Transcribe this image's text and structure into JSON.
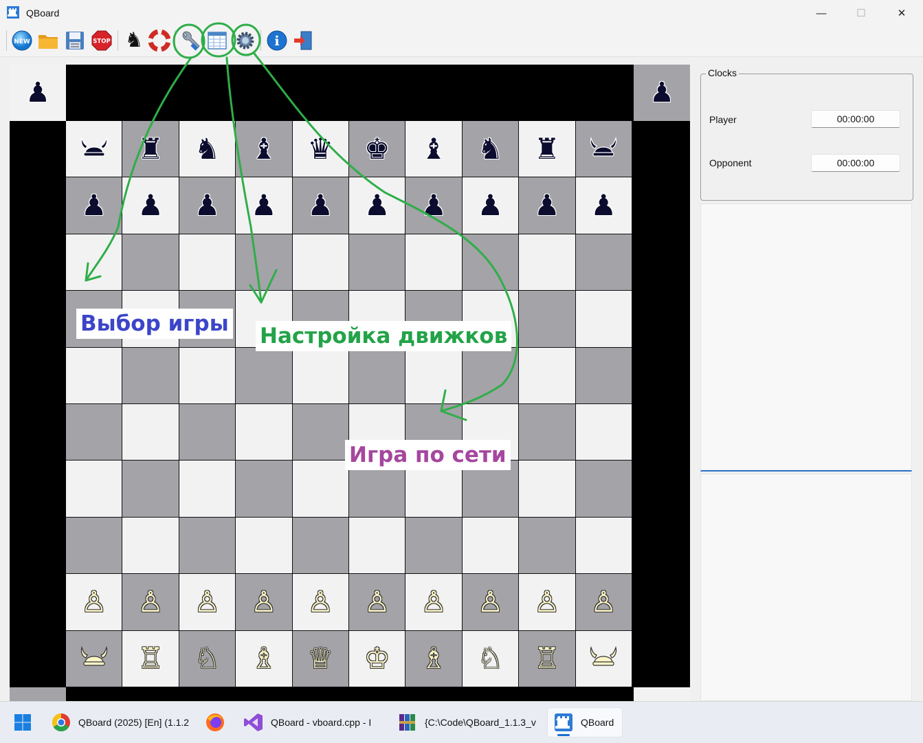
{
  "window": {
    "title": "QBoard",
    "minimize_glyph": "—",
    "maximize_glyph": "☐",
    "close_glyph": "✕"
  },
  "toolbar": {
    "buttons": [
      {
        "icon": "new-icon",
        "label": "NEW"
      },
      {
        "icon": "open-folder-icon"
      },
      {
        "icon": "save-icon"
      },
      {
        "icon": "stop-icon",
        "label": "STOP"
      },
      {
        "icon": "chess-knight-icon"
      },
      {
        "icon": "lifebuoy-icon"
      },
      {
        "icon": "wrench-icon"
      },
      {
        "icon": "table-icon"
      },
      {
        "icon": "gear-icon"
      },
      {
        "icon": "info-icon",
        "label": "i"
      },
      {
        "icon": "exit-door-icon"
      }
    ]
  },
  "board": {
    "files": 10,
    "ranks": 10,
    "corner_pieces": {
      "top_left": "♟",
      "top_right": "♟"
    },
    "rank_black_back": [
      "⚓viking",
      "♜",
      "♞",
      "♝",
      "♛",
      "♚",
      "♝",
      "♞",
      "♜",
      "⚓viking"
    ],
    "rank_black_pawns": [
      "♟",
      "♟",
      "♟",
      "♟",
      "♟",
      "♟",
      "♟",
      "♟",
      "♟",
      "♟"
    ],
    "rank_white_pawns": [
      "♙",
      "♙",
      "♙",
      "♙",
      "♙",
      "♙",
      "♙",
      "♙",
      "♙",
      "♙"
    ],
    "rank_white_back": [
      "⚓viking",
      "♖",
      "♘",
      "♗",
      "♕",
      "♔",
      "♗",
      "♘",
      "♖",
      "⚓viking"
    ],
    "colors": {
      "light": "#f2f2f2",
      "dark": "#a3a3a8",
      "frame": "#000000"
    }
  },
  "annotations": {
    "game_select": {
      "text": "Выбор игры",
      "color": "#3c45c8"
    },
    "engine_setup": {
      "text": "Настройка движков",
      "color": "#23a348"
    },
    "network_play": {
      "text": "Игра по сети",
      "color": "#a5479e"
    },
    "arrow_color": "#2fae48"
  },
  "clocks": {
    "legend": "Clocks",
    "player_label": "Player",
    "player_time": "00:00:00",
    "opponent_label": "Opponent",
    "opponent_time": "00:00:00"
  },
  "taskbar": {
    "items": [
      {
        "icon": "windows-start-icon"
      },
      {
        "icon": "chrome-icon",
        "label": "QBoard (2025) [En] (1.1.2"
      },
      {
        "icon": "firefox-icon"
      },
      {
        "icon": "visual-studio-icon",
        "label": "QBoard - vboard.cpp - I"
      },
      {
        "icon": "winrar-icon",
        "label": "{C:\\Code\\QBoard_1.1.3_v"
      },
      {
        "icon": "qboard-icon",
        "label": "QBoard"
      }
    ]
  }
}
